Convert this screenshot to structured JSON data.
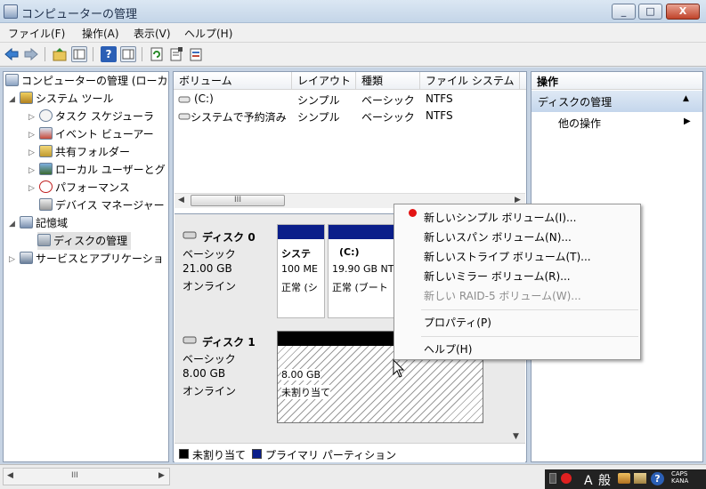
{
  "window": {
    "title": "コンピューターの管理",
    "min_label": "_",
    "max_label": "□",
    "close_label": "X"
  },
  "menu": [
    {
      "label": "ファイル(F)"
    },
    {
      "label": "操作(A)"
    },
    {
      "label": "表示(V)"
    },
    {
      "label": "ヘルプ(H)"
    }
  ],
  "toolbar_icons": [
    "back-arrow-icon",
    "forward-arrow-icon",
    "up-folder-icon",
    "show-hide-tree-icon",
    "help-icon",
    "show-hide-action-pane-icon",
    "refresh-icon",
    "properties-icon",
    "export-icon"
  ],
  "tree": {
    "root": "コンピューターの管理 (ローカ",
    "system_tools": "システム ツール",
    "task_scheduler": "タスク スケジューラ",
    "event_viewer": "イベント ビューアー",
    "shared_folders": "共有フォルダー",
    "local_users": "ローカル ユーザーとグ",
    "performance": "パフォーマンス",
    "device_manager": "デバイス マネージャー",
    "storage": "記憶域",
    "disk_management": "ディスクの管理",
    "services": "サービスとアプリケーショ"
  },
  "volume_list": {
    "columns": [
      "ボリューム",
      "レイアウト",
      "種類",
      "ファイル システム"
    ],
    "rows": [
      {
        "volume": "(C:)",
        "layout": "シンプル",
        "type": "ベーシック",
        "fs": "NTFS"
      },
      {
        "volume": "システムで予約済み",
        "layout": "シンプル",
        "type": "ベーシック",
        "fs": "NTFS"
      }
    ],
    "scroll_thumb_label": "III"
  },
  "disks": [
    {
      "name": "ディスク 0",
      "type": "ベーシック",
      "size": "21.00 GB",
      "status": "オンライン",
      "partitions": [
        {
          "title": "システ",
          "size": "100 ME",
          "status": "正常 (シ"
        },
        {
          "title": "(C:)",
          "size": "19.90 GB NT",
          "status": "正常 (ブート"
        }
      ]
    },
    {
      "name": "ディスク 1",
      "type": "ベーシック",
      "size": "8.00 GB",
      "status": "オンライン",
      "partitions": [
        {
          "size": "8.00 GB",
          "status": "未割り当て"
        }
      ]
    }
  ],
  "legend": {
    "unallocated": "未割り当て",
    "primary": "プライマリ パーティション",
    "unallocated_color": "#000000",
    "primary_color": "#0a1e8a"
  },
  "actions": {
    "title": "操作",
    "section": "ディスクの管理",
    "more": "他の操作",
    "section_arrow": "▲",
    "more_arrow": "▶"
  },
  "context_menu": {
    "items": [
      {
        "label": "新しいシンプル ボリューム(I)...",
        "enabled": true
      },
      {
        "label": "新しいスパン ボリューム(N)...",
        "enabled": true
      },
      {
        "label": "新しいストライプ ボリューム(T)...",
        "enabled": true
      },
      {
        "label": "新しいミラー ボリューム(R)...",
        "enabled": true
      },
      {
        "label": "新しい RAID-5 ボリューム(W)...",
        "enabled": false
      },
      {
        "label": "プロパティ(P)",
        "enabled": true
      },
      {
        "label": "ヘルプ(H)",
        "enabled": true
      }
    ]
  },
  "statusbar": {
    "scroll_thumb_label": "III"
  },
  "tray": {
    "ime_text": "A 般",
    "caps": "CAPS",
    "kana": "KANA"
  }
}
